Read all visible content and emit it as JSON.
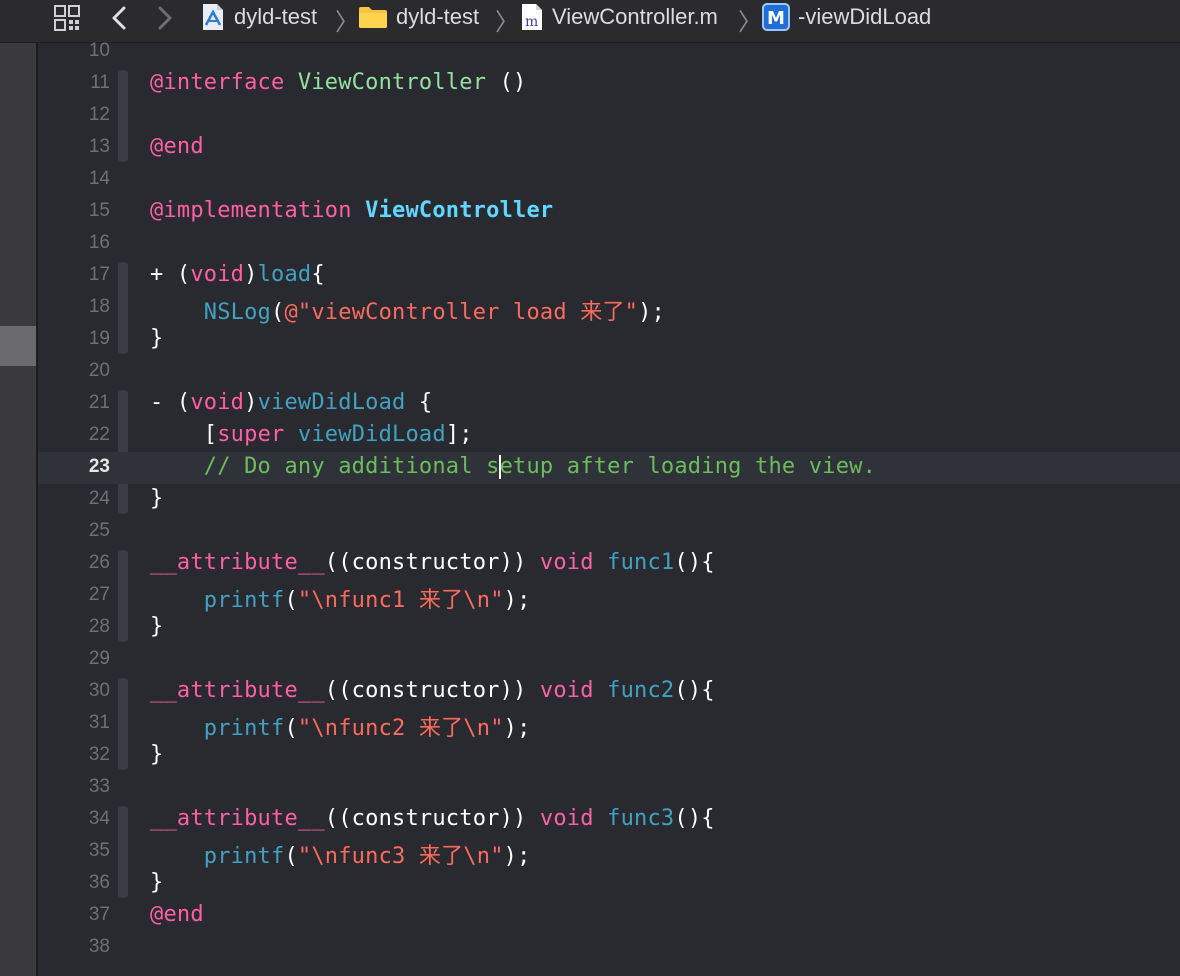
{
  "jumpbar": {
    "crumbs": [
      {
        "label": "dyld-test",
        "icon": "xcode-project-icon"
      },
      {
        "label": "dyld-test",
        "icon": "folder-icon"
      },
      {
        "label": "ViewController.m",
        "icon": "objc-m-file-icon"
      },
      {
        "label": "-viewDidLoad",
        "icon": "method-m-icon"
      }
    ]
  },
  "editor": {
    "current_line": "23",
    "lines": [
      {
        "n": "10",
        "t": []
      },
      {
        "n": "11",
        "t": [
          {
            "c": "kw",
            "s": "@interface "
          },
          {
            "c": "cls",
            "s": "ViewController"
          },
          {
            "c": "pl",
            "s": " ()"
          }
        ]
      },
      {
        "n": "12",
        "t": []
      },
      {
        "n": "13",
        "t": [
          {
            "c": "kw",
            "s": "@end"
          }
        ]
      },
      {
        "n": "14",
        "t": []
      },
      {
        "n": "15",
        "t": [
          {
            "c": "kw",
            "s": "@implementation "
          },
          {
            "c": "cls2",
            "s": "ViewController"
          }
        ]
      },
      {
        "n": "16",
        "t": []
      },
      {
        "n": "17",
        "t": [
          {
            "c": "pl",
            "s": "+ ("
          },
          {
            "c": "kw",
            "s": "void"
          },
          {
            "c": "pl",
            "s": ")"
          },
          {
            "c": "fn",
            "s": "load"
          },
          {
            "c": "pl",
            "s": "{"
          }
        ]
      },
      {
        "n": "18",
        "t": [
          {
            "c": "pl",
            "s": "    "
          },
          {
            "c": "fn",
            "s": "NSLog"
          },
          {
            "c": "pl",
            "s": "("
          },
          {
            "c": "str",
            "s": "@\"viewController load 来了\""
          },
          {
            "c": "pl",
            "s": ");"
          }
        ]
      },
      {
        "n": "19",
        "t": [
          {
            "c": "pl",
            "s": "}"
          }
        ]
      },
      {
        "n": "20",
        "t": []
      },
      {
        "n": "21",
        "t": [
          {
            "c": "pl",
            "s": "- ("
          },
          {
            "c": "kw",
            "s": "void"
          },
          {
            "c": "pl",
            "s": ")"
          },
          {
            "c": "fn",
            "s": "viewDidLoad"
          },
          {
            "c": "pl",
            "s": " {"
          }
        ]
      },
      {
        "n": "22",
        "t": [
          {
            "c": "pl",
            "s": "    ["
          },
          {
            "c": "kw",
            "s": "super"
          },
          {
            "c": "pl",
            "s": " "
          },
          {
            "c": "fn",
            "s": "viewDidLoad"
          },
          {
            "c": "pl",
            "s": "];"
          }
        ]
      },
      {
        "n": "23",
        "t": [
          {
            "c": "cm",
            "s": "    // Do any additional s"
          },
          {
            "c": "caret",
            "s": ""
          },
          {
            "c": "cm",
            "s": "etup after loading the view."
          }
        ]
      },
      {
        "n": "24",
        "t": [
          {
            "c": "pl",
            "s": "}"
          }
        ]
      },
      {
        "n": "25",
        "t": []
      },
      {
        "n": "26",
        "t": [
          {
            "c": "kw",
            "s": "__attribute__"
          },
          {
            "c": "pl",
            "s": "((constructor)) "
          },
          {
            "c": "kw",
            "s": "void"
          },
          {
            "c": "pl",
            "s": " "
          },
          {
            "c": "fn",
            "s": "func1"
          },
          {
            "c": "pl",
            "s": "(){"
          }
        ]
      },
      {
        "n": "27",
        "t": [
          {
            "c": "pl",
            "s": "    "
          },
          {
            "c": "fn",
            "s": "printf"
          },
          {
            "c": "pl",
            "s": "("
          },
          {
            "c": "str",
            "s": "\"\\nfunc1 来了\\n\""
          },
          {
            "c": "pl",
            "s": ");"
          }
        ]
      },
      {
        "n": "28",
        "t": [
          {
            "c": "pl",
            "s": "}"
          }
        ]
      },
      {
        "n": "29",
        "t": []
      },
      {
        "n": "30",
        "t": [
          {
            "c": "kw",
            "s": "__attribute__"
          },
          {
            "c": "pl",
            "s": "((constructor)) "
          },
          {
            "c": "kw",
            "s": "void"
          },
          {
            "c": "pl",
            "s": " "
          },
          {
            "c": "fn",
            "s": "func2"
          },
          {
            "c": "pl",
            "s": "(){"
          }
        ]
      },
      {
        "n": "31",
        "t": [
          {
            "c": "pl",
            "s": "    "
          },
          {
            "c": "fn",
            "s": "printf"
          },
          {
            "c": "pl",
            "s": "("
          },
          {
            "c": "str",
            "s": "\"\\nfunc2 来了\\n\""
          },
          {
            "c": "pl",
            "s": ");"
          }
        ]
      },
      {
        "n": "32",
        "t": [
          {
            "c": "pl",
            "s": "}"
          }
        ]
      },
      {
        "n": "33",
        "t": []
      },
      {
        "n": "34",
        "t": [
          {
            "c": "kw",
            "s": "__attribute__"
          },
          {
            "c": "pl",
            "s": "((constructor)) "
          },
          {
            "c": "kw",
            "s": "void"
          },
          {
            "c": "pl",
            "s": " "
          },
          {
            "c": "fn",
            "s": "func3"
          },
          {
            "c": "pl",
            "s": "(){"
          }
        ]
      },
      {
        "n": "35",
        "t": [
          {
            "c": "pl",
            "s": "    "
          },
          {
            "c": "fn",
            "s": "printf"
          },
          {
            "c": "pl",
            "s": "("
          },
          {
            "c": "str",
            "s": "\"\\nfunc3 来了\\n\""
          },
          {
            "c": "pl",
            "s": ");"
          }
        ]
      },
      {
        "n": "36",
        "t": [
          {
            "c": "pl",
            "s": "}"
          }
        ]
      },
      {
        "n": "37",
        "t": [
          {
            "c": "kw",
            "s": "@end"
          }
        ]
      },
      {
        "n": "38",
        "t": []
      }
    ]
  },
  "colors": {
    "background": "#292a30",
    "keyword": "#fc5fa3",
    "function": "#41a1c0",
    "string": "#fc6a5d",
    "comment": "#6bbd5b",
    "class_decl": "#92e1a0",
    "class_impl": "#5dd8ff"
  }
}
